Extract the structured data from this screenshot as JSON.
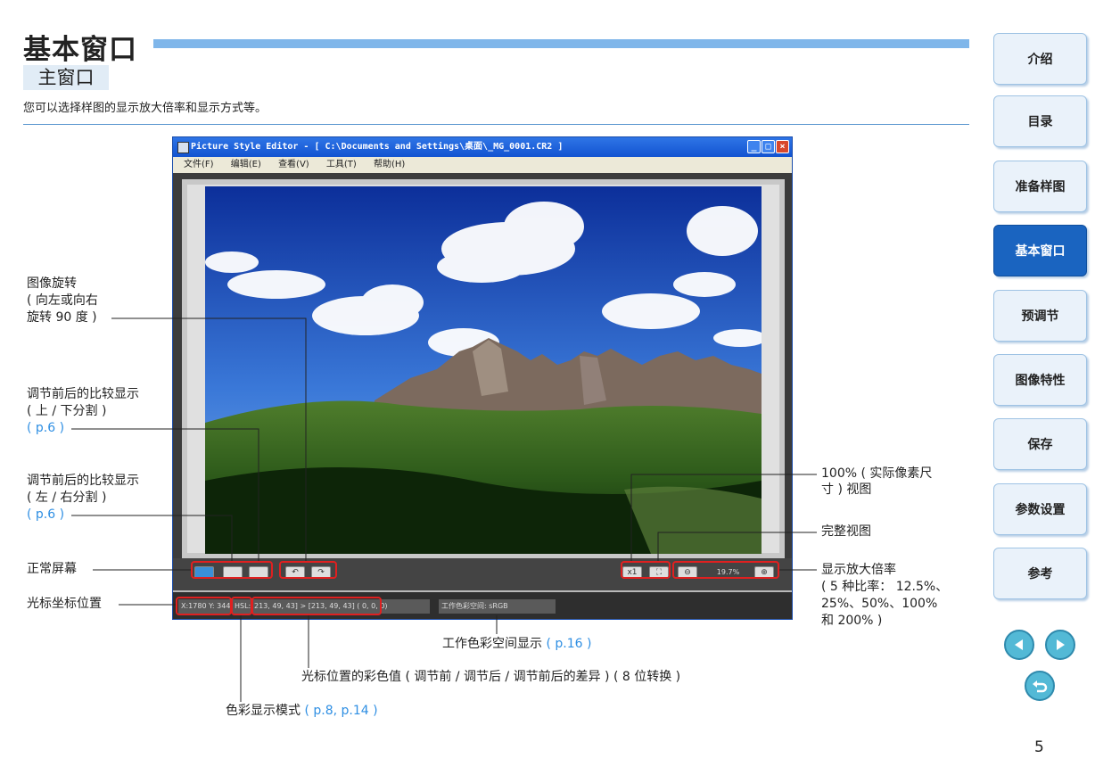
{
  "header": {
    "title": "基本窗口",
    "section": "主窗口",
    "intro": "您可以选择样图的显示放大倍率和显示方式等。"
  },
  "nav": {
    "items": [
      {
        "label": "介绍",
        "active": false
      },
      {
        "label": "目录",
        "active": false
      },
      {
        "label": "准备样图",
        "active": false
      },
      {
        "label": "基本窗口",
        "active": true
      },
      {
        "label": "预调节",
        "active": false
      },
      {
        "label": "图像特性",
        "active": false
      },
      {
        "label": "保存",
        "active": false
      },
      {
        "label": "参数设置",
        "active": false
      },
      {
        "label": "参考",
        "active": false
      }
    ],
    "prev_icon": "arrow-left-icon",
    "next_icon": "arrow-right-icon",
    "return_icon": "return-icon"
  },
  "page_number": "5",
  "app": {
    "window_title": "Picture Style Editor - [ C:\\Documents and Settings\\桌面\\_MG_0001.CR2 ]",
    "menu": [
      "文件(F)",
      "编辑(E)",
      "查看(V)",
      "工具(T)",
      "帮助(H)"
    ],
    "toolbar": {
      "actual_size_label": "x1",
      "zoom_value": "19.7%"
    },
    "status": {
      "cursor": "X:1780 Y: 344",
      "color_mode": "HSL:",
      "color_values": "213, 49, 43] > [213, 49, 43] ( 0, 0, 0)",
      "workspace": "工作色彩空间: sRGB"
    }
  },
  "annotations": {
    "rotate_l1": "图像旋转",
    "rotate_l2": "( 向左或向右",
    "rotate_l3": "旋转 90 度 )",
    "ud_l1": "调节前后的比较显示",
    "ud_l2": "( 上 / 下分割 )",
    "ud_ref": "( p.6 )",
    "lr_l1": "调节前后的比较显示",
    "lr_l2": "( 左 / 右分割 )",
    "lr_ref": "( p.6 )",
    "normal": "正常屏幕",
    "cursor_pos": "光标坐标位置",
    "actual_l1": "100% ( 实际像素尺",
    "actual_l2": "寸 ) 视图",
    "fit": "完整视图",
    "zoom_l1": "显示放大倍率",
    "zoom_l2": "( 5 种比率： 12.5%、",
    "zoom_l3": "25%、50%、100%",
    "zoom_l4": "和 200% )",
    "workspace_text": "工作色彩空间显示",
    "workspace_ref": "( p.16 )",
    "color_value_text": "光标位置的彩色值 ( 调节前 / 调节后 / 调节前后的差异 ) ( 8 位转换 )",
    "color_mode_text": "色彩显示模式",
    "color_mode_ref": "( p.8, p.14 )"
  },
  "colors": {
    "accent_blue": "#2f8fe3",
    "title_bar": "#7fb6ea",
    "nav_active": "#1a64c0",
    "highlight_red": "#e02020"
  }
}
